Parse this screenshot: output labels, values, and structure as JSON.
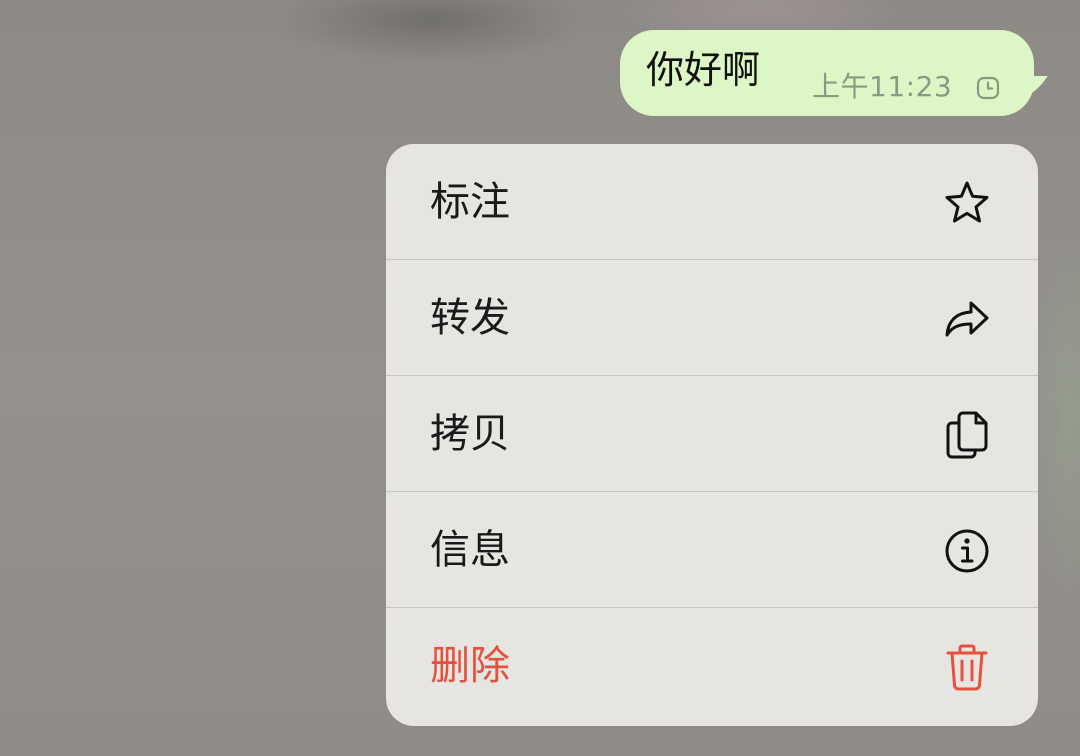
{
  "message": {
    "text": "你好啊",
    "time": "上午11:23",
    "status_icon": "clock-icon",
    "bubble_color": "#dcf7c5"
  },
  "menu": {
    "items": [
      {
        "label": "标注",
        "icon": "star-icon",
        "danger": false
      },
      {
        "label": "转发",
        "icon": "forward-arrow-icon",
        "danger": false
      },
      {
        "label": "拷贝",
        "icon": "copy-icon",
        "danger": false
      },
      {
        "label": "信息",
        "icon": "info-icon",
        "danger": false
      },
      {
        "label": "删除",
        "icon": "trash-icon",
        "danger": true
      }
    ],
    "danger_color": "#e4513d"
  }
}
